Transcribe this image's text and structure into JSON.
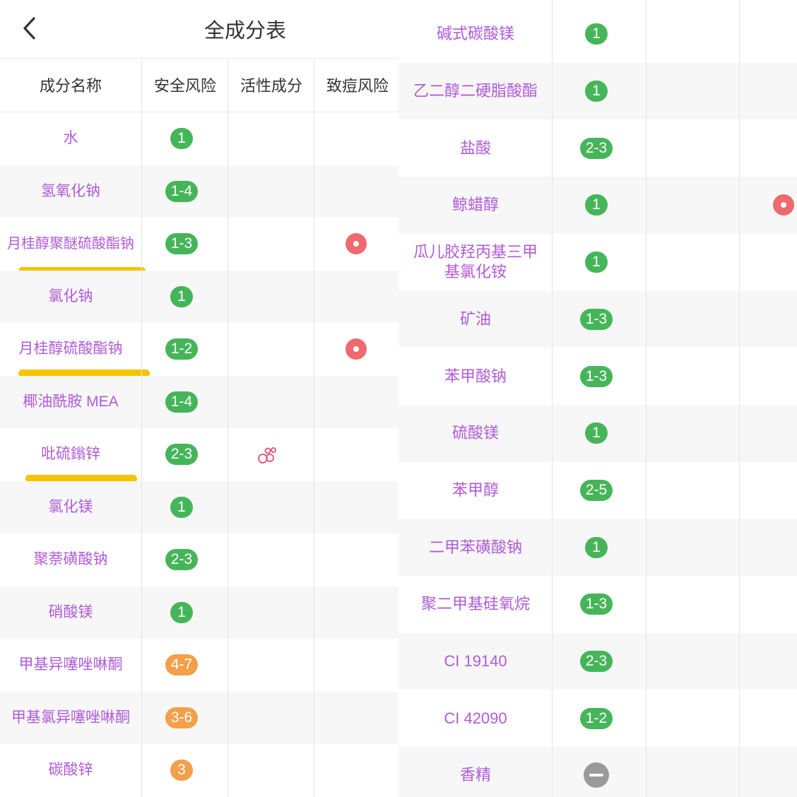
{
  "nav": {
    "title": "全成分表",
    "back_icon": "chevron-left-icon"
  },
  "columns": [
    "成分名称",
    "安全风险",
    "活性成分",
    "致痘风险"
  ],
  "colors": {
    "ingredient_text": "#b05bd8",
    "risk_low": "#46b55a",
    "risk_mid": "#f2a04a",
    "acne_dot": "#ef6a6e",
    "unknown": "#9a9a9a",
    "highlight": "#f5c400"
  },
  "left_rows": [
    {
      "name": "水",
      "safety": "1"
    },
    {
      "name": "氢氧化钠",
      "safety": "1-4"
    },
    {
      "name": "月桂醇聚醚硫酸酯钠",
      "safety": "1-3",
      "acne": true,
      "highlighted": true
    },
    {
      "name": "氯化钠",
      "safety": "1"
    },
    {
      "name": "月桂醇硫酸酯钠",
      "safety": "1-2",
      "acne": true,
      "highlighted": true
    },
    {
      "name": "椰油酰胺 MEA",
      "safety": "1-4"
    },
    {
      "name": "吡硫鎓锌",
      "safety": "2-3",
      "active": true,
      "highlighted": true
    },
    {
      "name": "氯化镁",
      "safety": "1"
    },
    {
      "name": "聚萘磺酸钠",
      "safety": "2-3"
    },
    {
      "name": "硝酸镁",
      "safety": "1"
    },
    {
      "name": "甲基异噻唑啉酮",
      "safety": "4-7"
    },
    {
      "name": "甲基氯异噻唑啉酮",
      "safety": "3-6"
    },
    {
      "name": "碳酸锌",
      "safety": "3"
    }
  ],
  "right_rows": [
    {
      "name": "碱式碳酸镁",
      "safety": "1"
    },
    {
      "name": "乙二醇二硬脂酸酯",
      "safety": "1"
    },
    {
      "name": "盐酸",
      "safety": "2-3"
    },
    {
      "name": "鲸蜡醇",
      "safety": "1",
      "acne": true
    },
    {
      "name": "瓜儿胶羟丙基三甲基氯化铵",
      "safety": "1"
    },
    {
      "name": "矿油",
      "safety": "1-3"
    },
    {
      "name": "苯甲酸钠",
      "safety": "1-3"
    },
    {
      "name": "硫酸镁",
      "safety": "1"
    },
    {
      "name": "苯甲醇",
      "safety": "2-5"
    },
    {
      "name": "二甲苯磺酸钠",
      "safety": "1"
    },
    {
      "name": "聚二甲基硅氧烷",
      "safety": "1-3"
    },
    {
      "name": "CI 19140",
      "safety": "2-3"
    },
    {
      "name": "CI 42090",
      "safety": "1-2"
    },
    {
      "name": "香精",
      "safety": "unknown"
    }
  ]
}
